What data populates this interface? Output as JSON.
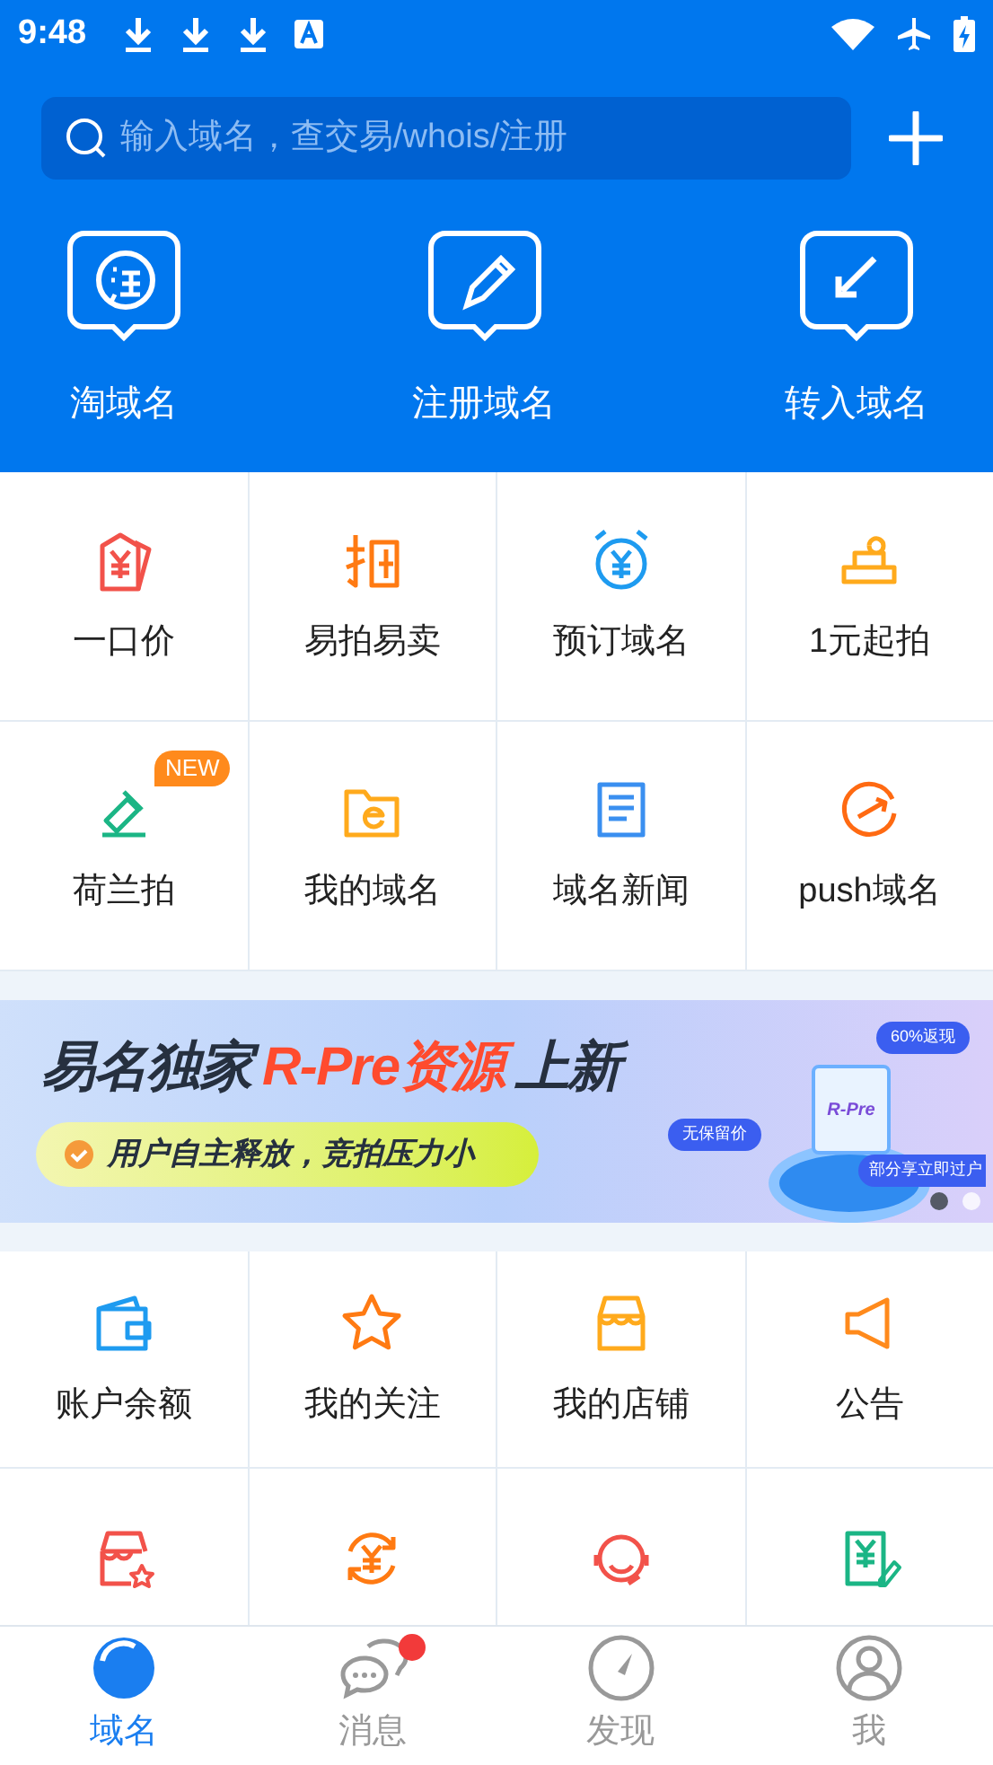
{
  "status_bar": {
    "time": "9:48"
  },
  "search": {
    "placeholder": "输入域名，查交易/whois/注册"
  },
  "quick_actions": [
    {
      "label": "淘域名"
    },
    {
      "label": "注册域名"
    },
    {
      "label": "转入域名"
    }
  ],
  "services": [
    {
      "label": "一口价"
    },
    {
      "label": "易拍易卖"
    },
    {
      "label": "预订域名"
    },
    {
      "label": "1元起拍"
    },
    {
      "label": "荷兰拍",
      "badge": "NEW"
    },
    {
      "label": "我的域名"
    },
    {
      "label": "域名新闻"
    },
    {
      "label": "push域名"
    }
  ],
  "banner": {
    "title_lead": "易名独家",
    "title_highlight": "R-Pre资源",
    "title_tail": "上新",
    "subtitle": "用户自主释放，竞拍压力小",
    "card_label": "R-Pre",
    "tags": [
      "60%返现",
      "无保留价",
      "部分享立即过户"
    ],
    "dots": [
      {
        "selected": true
      },
      {
        "selected": false
      }
    ]
  },
  "tools": [
    {
      "kind": "labelled",
      "label": "账户余额"
    },
    {
      "kind": "labelled",
      "label": "我的关注"
    },
    {
      "kind": "labelled",
      "label": "我的店铺"
    },
    {
      "kind": "labelled",
      "label": "公告"
    },
    {
      "kind": "icon_only"
    },
    {
      "kind": "icon_only"
    },
    {
      "kind": "icon_only"
    },
    {
      "kind": "icon_only"
    }
  ],
  "tabs": [
    {
      "label": "域名",
      "selected": true,
      "unread": false
    },
    {
      "label": "消息",
      "selected": false,
      "unread": true
    },
    {
      "label": "发现",
      "selected": false,
      "unread": false
    },
    {
      "label": "我",
      "selected": false,
      "unread": false
    }
  ]
}
